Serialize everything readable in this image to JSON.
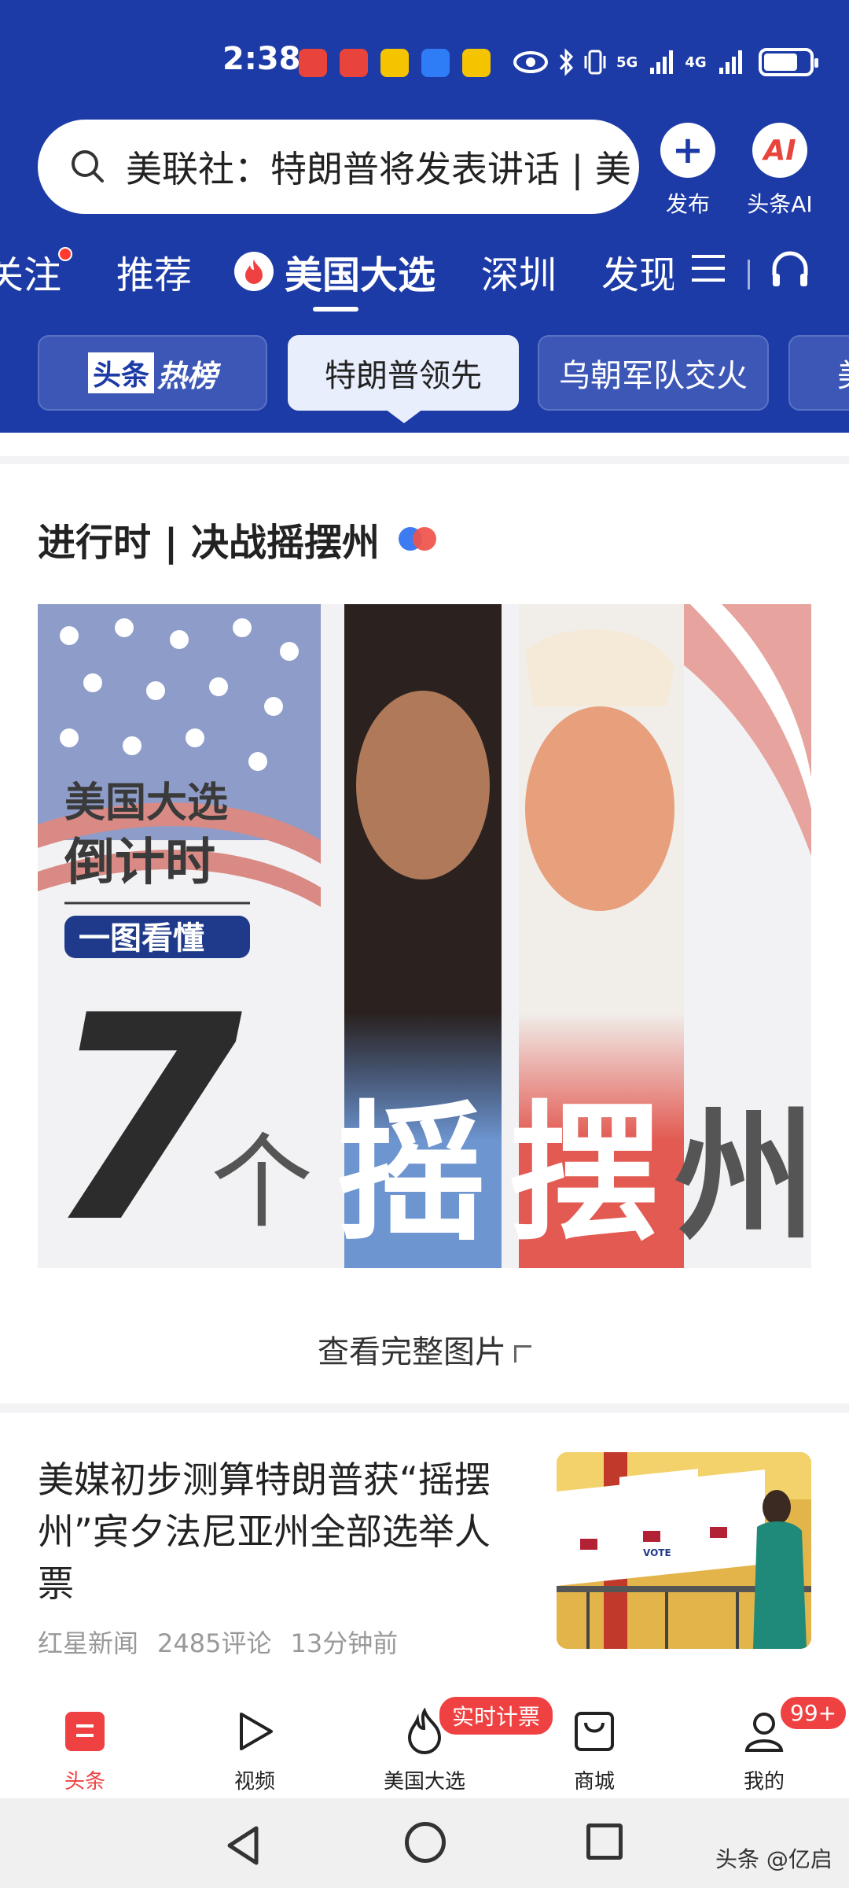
{
  "status_bar": {
    "time": "2:38",
    "network_labels": [
      "5G",
      "4G"
    ]
  },
  "header": {
    "search_text": "美联社：特朗普将发表讲话 | 美",
    "publish_label": "发布",
    "ai_label": "头条AI",
    "ai_icon_text": "AI"
  },
  "channel_tabs": [
    "关注",
    "推荐",
    "美国大选",
    "深圳",
    "发现"
  ],
  "hot_tags": {
    "hotlist_logo": "头条",
    "hotlist_text": "热榜",
    "items": [
      "特朗普领先",
      "乌朝军队交火",
      "美"
    ]
  },
  "card": {
    "title": "进行时 | 决战摇摆州",
    "view_full": "查看完整图片"
  },
  "hero_image_text": {
    "line1": "美国大选",
    "line2": "倒计时",
    "line3": "一图看懂",
    "big_number": "7",
    "ge": "个",
    "yao": "摇",
    "bai": "摆",
    "zhou": "州"
  },
  "news_item": {
    "title": "美媒初步测算特朗普获“摇摆州”宾夕法尼亚州全部选举人票",
    "source": "红星新闻",
    "comments": "2485评论",
    "time": "13分钟前",
    "thumb_text": "VOTE"
  },
  "bottom_nav": {
    "items": [
      "头条",
      "视频",
      "美国大选",
      "商城",
      "我的"
    ],
    "live_badge": "实时计票",
    "count_badge": "99+"
  },
  "watermark": "头条 @亿启",
  "colors": {
    "header_bg": "#1d3ba6",
    "accent_red": "#f04142"
  }
}
